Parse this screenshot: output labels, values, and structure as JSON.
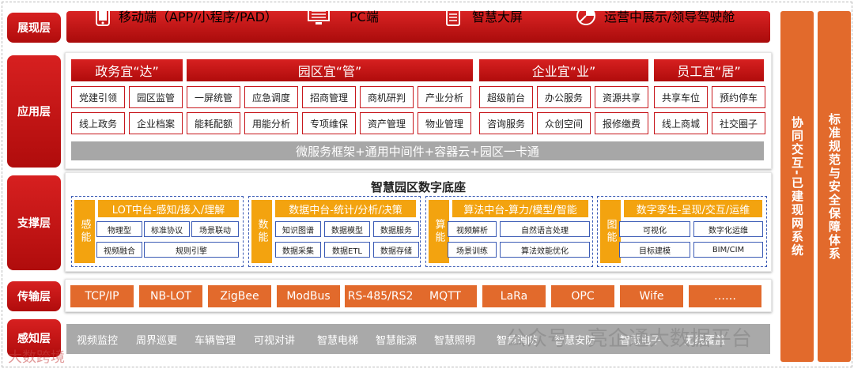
{
  "layers": {
    "presentation": "展现层",
    "application": "应用层",
    "support": "支撑层",
    "transport": "传输层",
    "perception": "感知层"
  },
  "presentation": [
    {
      "label": "移动端（APP/小程序/PAD）",
      "icon": "mobile-phone-icon"
    },
    {
      "label": "PC端",
      "icon": "pc-monitor-icon"
    },
    {
      "label": "智慧大屏",
      "icon": "clipboard-screen-icon"
    },
    {
      "label": "运营中展示/领导驾驶舱",
      "icon": "pie-chart-icon"
    }
  ],
  "application": {
    "categories": [
      "政务宜“达”",
      "园区宜“管”",
      "企业宜“业”",
      "员工宜“居”"
    ],
    "row1": [
      "党建引领",
      "园区监管",
      "一屏统管",
      "应急调度",
      "招商管理",
      "商机研判",
      "产业分析",
      "超级前台",
      "办公服务",
      "资源共享",
      "共享车位",
      "预约停车"
    ],
    "row2": [
      "线上政务",
      "企业档案",
      "能耗配额",
      "用能分析",
      "专项维保",
      "资产管理",
      "物业管理",
      "咨询服务",
      "众创空间",
      "报修缴费",
      "线上商城",
      "社交圈子"
    ],
    "footer": "微服务框架+通用中间件+容器云+园区一卡通"
  },
  "support": {
    "title": "智慧园区数字底座",
    "groups": [
      {
        "side": "感能",
        "title": "LOT中台-感知/接入/理解",
        "cells": [
          "物理型",
          "标准协议",
          "场景联动",
          "视频融合",
          "规则引擎"
        ]
      },
      {
        "side": "数能",
        "title": "数据中台-统计/分析/决策",
        "cells": [
          "知识图谱",
          "数据模型",
          "数据服务",
          "数据采集",
          "数据ETL",
          "数据存储"
        ]
      },
      {
        "side": "算能",
        "title": "算法中台-算力/模型/智能",
        "cells": [
          "视频解析",
          "自然语言处理",
          "场景训练",
          "算法效能优化"
        ]
      },
      {
        "side": "图能",
        "title": "数字孪生-呈现/交互/运维",
        "cells": [
          "可视化",
          "数字化运维",
          "目标建模",
          "BIM/CIM"
        ]
      }
    ]
  },
  "transport": [
    "TCP/IP",
    "NB-LOT",
    "ZigBee",
    "ModBus",
    "RS-485/RS232",
    "MQTT",
    "LaRa",
    "OPC",
    "Wife",
    "……"
  ],
  "perception": [
    "视频监控",
    "周界巡更",
    "车辆管理",
    "可视对讲",
    "智慧电梯",
    "智慧能源",
    "智慧照明",
    "智慧消防",
    "智慧安防",
    "智慧电子",
    "无线覆盖"
  ],
  "side_columns": [
    "协同交互-已建现网系统",
    "标准规范与安全保障体系"
  ],
  "watermarks": {
    "wechat": "公众号 · 亮企通大数据平台",
    "corner": "大数跨境"
  },
  "colors": {
    "red": "#c7171c",
    "orange": "#e26a2c",
    "amber": "#f3a30f",
    "gray": "#a9a9a9",
    "blue": "#3b5bb5"
  }
}
